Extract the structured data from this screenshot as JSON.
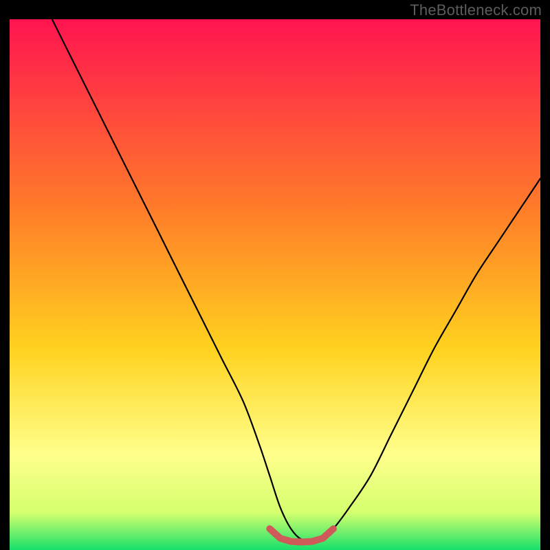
{
  "watermark": "TheBottleneck.com",
  "colors": {
    "black": "#000000",
    "curve": "#000000",
    "marker": "#cf5a5a",
    "grad_top": "#ff1450",
    "grad_mid1": "#ff7a2a",
    "grad_mid2": "#ffd21e",
    "grad_low1": "#ffff8c",
    "grad_low2": "#d4ff6e",
    "grad_bottom": "#17e06a"
  },
  "chart_data": {
    "type": "line",
    "title": "",
    "xlabel": "",
    "ylabel": "",
    "xlim": [
      0,
      100
    ],
    "ylim": [
      0,
      100
    ],
    "x": [
      8,
      12,
      16,
      20,
      24,
      28,
      32,
      36,
      40,
      44,
      47,
      49,
      51,
      53,
      55,
      57,
      59,
      61,
      64,
      68,
      72,
      76,
      80,
      84,
      88,
      92,
      96,
      100
    ],
    "values": [
      100,
      92,
      84,
      76,
      68,
      60,
      52,
      44,
      36,
      28,
      20,
      14,
      8,
      4,
      2,
      2,
      2,
      4,
      8,
      14,
      22,
      30,
      38,
      45,
      52,
      58,
      64,
      70
    ],
    "markers": {
      "x": [
        49,
        51,
        53,
        55,
        57,
        59,
        61
      ],
      "y": [
        4,
        2.2,
        1.6,
        1.5,
        1.6,
        2.2,
        4
      ]
    }
  }
}
